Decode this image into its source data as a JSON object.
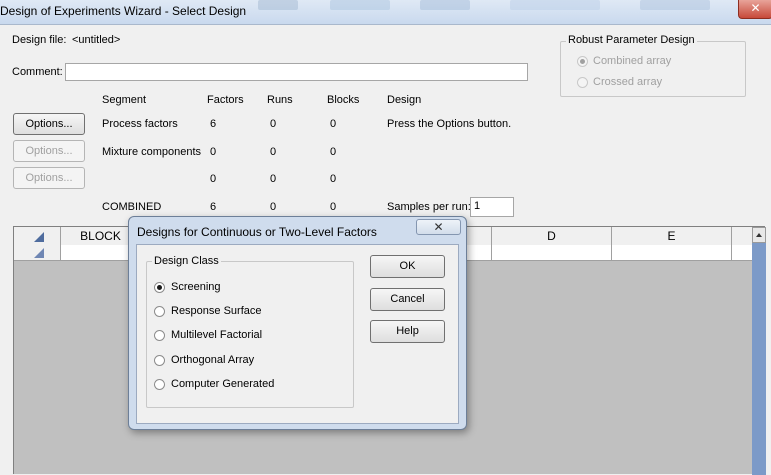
{
  "window": {
    "title": "Design of Experiments Wizard - Select Design"
  },
  "form": {
    "design_file_label": "Design file:",
    "design_file_value": "<untitled>",
    "comment_label": "Comment:",
    "comment_value": ""
  },
  "robust": {
    "title": "Robust Parameter Design",
    "options": [
      "Combined array",
      "Crossed array"
    ],
    "selected": "Combined array"
  },
  "segments": {
    "headers": [
      "Segment",
      "Factors",
      "Runs",
      "Blocks",
      "Design"
    ],
    "rows": [
      {
        "button": "Options...",
        "segment": "Process factors",
        "factors": "6",
        "runs": "0",
        "blocks": "0",
        "design": "Press the Options button.",
        "enabled": true
      },
      {
        "button": "Options...",
        "segment": "Mixture components",
        "factors": "0",
        "runs": "0",
        "blocks": "0",
        "design": "",
        "enabled": false
      },
      {
        "button": "Options...",
        "segment": "",
        "factors": "0",
        "runs": "0",
        "blocks": "0",
        "design": "",
        "enabled": false
      }
    ],
    "combined": {
      "label": "COMBINED",
      "factors": "6",
      "runs": "0",
      "blocks": "0"
    },
    "samples_label": "Samples per run:",
    "samples_value": "1"
  },
  "grid": {
    "columns": [
      "BLOCK",
      "D",
      "E"
    ]
  },
  "dialog": {
    "title": "Designs for Continuous or Two-Level Factors",
    "close_glyph": "✕",
    "group_title": "Design Class",
    "options": [
      "Screening",
      "Response Surface",
      "Multilevel Factorial",
      "Orthogonal Array",
      "Computer Generated"
    ],
    "selected": "Screening",
    "buttons": {
      "ok": "OK",
      "cancel": "Cancel",
      "help": "Help"
    }
  }
}
